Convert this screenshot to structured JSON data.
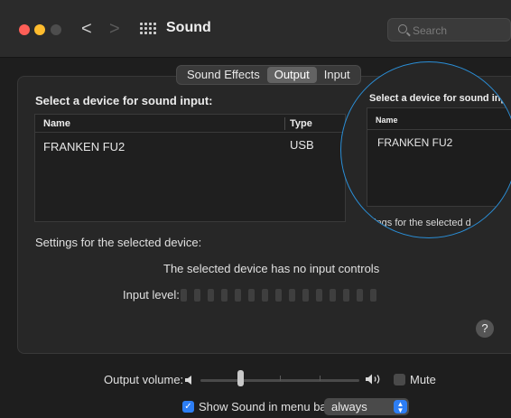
{
  "window": {
    "title": "Sound",
    "search_placeholder": "Search",
    "back_glyph": "<",
    "forward_glyph": ">"
  },
  "tabs": [
    {
      "label": "Sound Effects",
      "active": false
    },
    {
      "label": "Output",
      "active": true
    },
    {
      "label": "Input",
      "active": false
    }
  ],
  "input_section": {
    "title": "Select a device for sound input:",
    "columns": [
      "Name",
      "Type"
    ],
    "rows": [
      {
        "name": "FRANKEN FU2",
        "type": "USB"
      }
    ],
    "settings_label": "Settings for the selected device:",
    "no_controls_text": "The selected device has no input controls",
    "input_level_label": "Input level:",
    "input_level_segments": 15
  },
  "zoom_callout": {
    "title": "Select a device for sound inp",
    "column": "Name",
    "row": "FRANKEN FU2",
    "settings_text": "ttings for the selected d"
  },
  "help_label": "?",
  "output_volume": {
    "label": "Output volume:",
    "level": 0.25
  },
  "mute": {
    "label": "Mute",
    "checked": false
  },
  "menu_bar": {
    "checked": true,
    "label": "Show Sound in menu bar",
    "check_glyph": "✓",
    "select_value": "always"
  },
  "icons": {
    "speaker_low": "speaker-low-icon",
    "speaker_high": "speaker-high-icon",
    "grid": "grid-icon",
    "search": "search-icon"
  },
  "colors": {
    "accent": "#2d7ef5",
    "callout_ring": "#2a8fd8",
    "close": "#fe5f57",
    "minimize": "#febc2e"
  }
}
